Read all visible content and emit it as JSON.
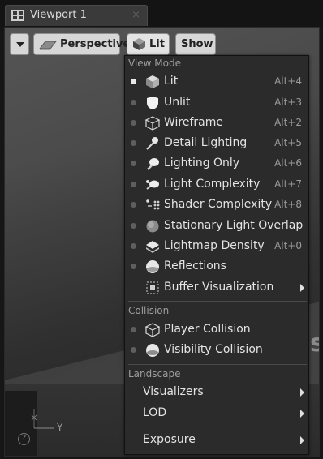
{
  "tab": {
    "title": "Viewport 1",
    "close": "×"
  },
  "toolbar": {
    "perspective": "Perspective",
    "lit": "Lit",
    "show": "Show"
  },
  "menu": {
    "view_mode_header": "View Mode",
    "view_modes": [
      {
        "label": "Lit",
        "shortcut": "Alt+4",
        "icon": "lit-cube-icon",
        "selected": true
      },
      {
        "label": "Unlit",
        "shortcut": "Alt+3",
        "icon": "shield-icon",
        "selected": false
      },
      {
        "label": "Wireframe",
        "shortcut": "Alt+2",
        "icon": "wireframe-cube-icon",
        "selected": false
      },
      {
        "label": "Detail Lighting",
        "shortcut": "Alt+5",
        "icon": "detail-lighting-icon",
        "selected": false
      },
      {
        "label": "Lighting Only",
        "shortcut": "Alt+6",
        "icon": "lighting-only-icon",
        "selected": false
      },
      {
        "label": "Light Complexity",
        "shortcut": "Alt+7",
        "icon": "light-complexity-icon",
        "selected": false
      },
      {
        "label": "Shader Complexity",
        "shortcut": "Alt+8",
        "icon": "shader-complexity-icon",
        "selected": false
      },
      {
        "label": "Stationary Light Overlap",
        "shortcut": "",
        "icon": "stationary-light-overlap-icon",
        "selected": false
      },
      {
        "label": "Lightmap Density",
        "shortcut": "Alt+0",
        "icon": "lightmap-density-icon",
        "selected": false
      },
      {
        "label": "Reflections",
        "shortcut": "",
        "icon": "reflections-sphere-icon",
        "selected": false
      }
    ],
    "buffer_visualization": "Buffer Visualization",
    "collision_header": "Collision",
    "collision": [
      {
        "label": "Player Collision",
        "icon": "player-collision-icon"
      },
      {
        "label": "Visibility Collision",
        "icon": "visibility-collision-icon"
      }
    ],
    "landscape_header": "Landscape",
    "landscape": [
      {
        "label": "Visualizers"
      },
      {
        "label": "LOD"
      }
    ],
    "exposure": "Exposure"
  },
  "viewport": {
    "axis_label": "Y",
    "help": "?",
    "background_letter": "s"
  }
}
